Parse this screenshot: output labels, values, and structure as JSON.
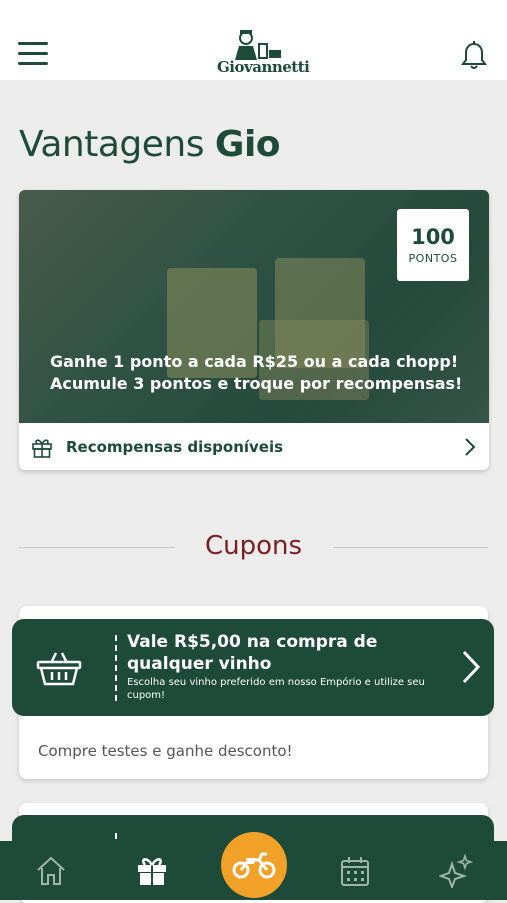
{
  "header": {
    "logo_text": "Giovannetti",
    "menu_icon": "hamburger-menu-icon",
    "bell_icon": "bell-icon"
  },
  "page": {
    "title_prefix": "Vantagens",
    "title_bold": "Gio"
  },
  "hero": {
    "points_value": "100",
    "points_label": "PONTOS",
    "text_line1": "Ganhe 1 ponto a cada R$25 ou a cada chopp!",
    "text_line2": "Acumule 3 pontos e troque por recompensas!",
    "rewards_label": "Recompensas disponíveis"
  },
  "coupons": {
    "section_title": "Cupons",
    "items": [
      {
        "title": "Vale R$5,00 na compra de qualquer vinho",
        "description": "Escolha seu vinho preferido em nosso Empório e utilize seu cupom!",
        "footer": "Compre testes e ganhe desconto!"
      }
    ]
  },
  "bottom_nav": {
    "items": [
      "home-icon",
      "gift-icon",
      "motorcycle-icon",
      "calendar-icon",
      "sparkles-icon"
    ],
    "active": "gift-icon"
  },
  "colors": {
    "brand_green": "#1e4a3a",
    "accent_orange": "#f2a128",
    "section_title_red": "#7a1f24",
    "background": "#ececec"
  }
}
